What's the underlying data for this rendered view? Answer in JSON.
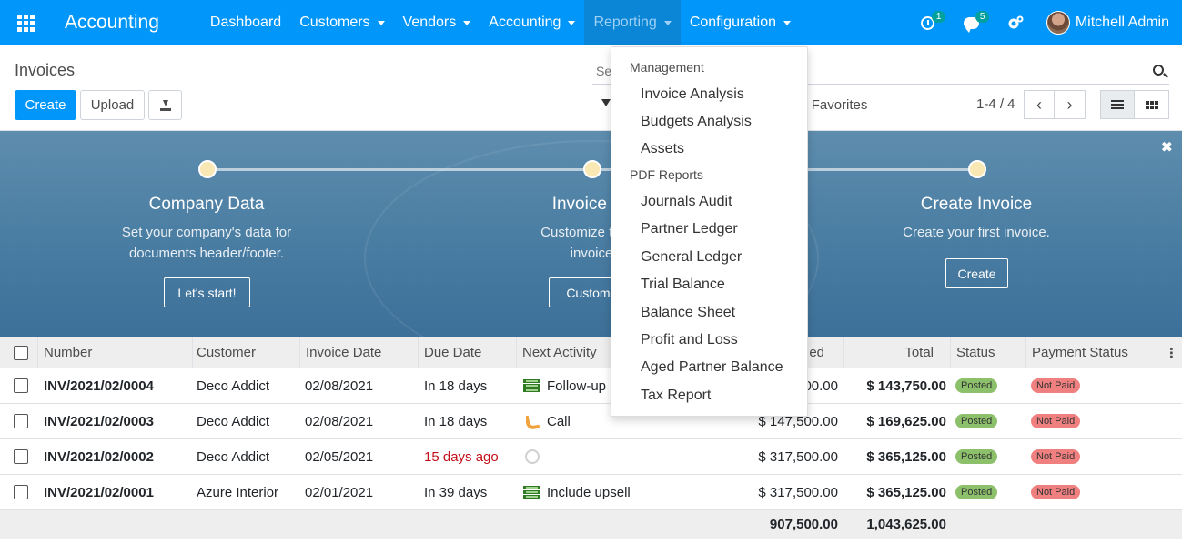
{
  "navbar": {
    "brand": "Accounting",
    "menu": [
      {
        "label": "Dashboard",
        "dropdown": false
      },
      {
        "label": "Customers",
        "dropdown": true
      },
      {
        "label": "Vendors",
        "dropdown": true
      },
      {
        "label": "Accounting",
        "dropdown": true
      },
      {
        "label": "Reporting",
        "dropdown": true
      },
      {
        "label": "Configuration",
        "dropdown": true
      }
    ],
    "activity_count": "1",
    "message_count": "5",
    "user_name": "Mitchell Admin",
    "accent_color": "#0196f9"
  },
  "control": {
    "breadcrumb": "Invoices",
    "create_label": "Create",
    "upload_label": "Upload",
    "search_placeholder": "Search...",
    "favorites_label": "Favorites",
    "pager": "1-4 / 4"
  },
  "banner": {
    "steps": [
      {
        "title": "Company Data",
        "desc_line1": "Set your company's data for",
        "desc_line2": "documents header/footer.",
        "button": "Let's start!"
      },
      {
        "title": "Invoice La",
        "desc_line1": "Customize the lo",
        "desc_line2": "invoice",
        "button": "Customi"
      },
      {
        "title": "Create Invoice",
        "desc_line1": "Create your first invoice.",
        "desc_line2": "",
        "button": "Create"
      }
    ]
  },
  "table": {
    "headers": {
      "number": "Number",
      "customer": "Customer",
      "invoice_date": "Invoice Date",
      "due_date": "Due Date",
      "next_activity": "Next Activity",
      "untaxed": "ed",
      "total": "Total",
      "status": "Status",
      "payment_status": "Payment Status"
    },
    "rows": [
      {
        "number": "INV/2021/02/0004",
        "customer": "Deco Addict",
        "invoice_date": "02/08/2021",
        "due_date": "In 18 days",
        "activity": "Follow-up",
        "activity_icon": "todo-icon",
        "untaxed": "00.00",
        "total": "$ 143,750.00",
        "status": "Posted",
        "payment": "Not Paid"
      },
      {
        "number": "INV/2021/02/0003",
        "customer": "Deco Addict",
        "invoice_date": "02/08/2021",
        "due_date": "In 18 days",
        "activity": "Call",
        "activity_icon": "phone-icon",
        "untaxed": "$ 147,500.00",
        "total": "$ 169,625.00",
        "status": "Posted",
        "payment": "Not Paid"
      },
      {
        "number": "INV/2021/02/0002",
        "customer": "Deco Addict",
        "invoice_date": "02/05/2021",
        "due_date": "15 days ago",
        "activity": "",
        "activity_icon": "clock-icon",
        "untaxed": "$ 317,500.00",
        "total": "$ 365,125.00",
        "status": "Posted",
        "payment": "Not Paid"
      },
      {
        "number": "INV/2021/02/0001",
        "customer": "Azure Interior",
        "invoice_date": "02/01/2021",
        "due_date": "In 39 days",
        "activity": "Include upsell",
        "activity_icon": "todo-icon",
        "untaxed": "$ 317,500.00",
        "total": "$ 365,125.00",
        "status": "Posted",
        "payment": "Not Paid"
      }
    ],
    "footer": {
      "untaxed": "907,500.00",
      "total": "1,043,625.00"
    }
  },
  "dropdown": {
    "section1": "Management",
    "management_items": [
      "Invoice Analysis",
      "Budgets Analysis",
      "Assets"
    ],
    "section2": "PDF Reports",
    "pdf_items": [
      "Journals Audit",
      "Partner Ledger",
      "General Ledger",
      "Trial Balance",
      "Balance Sheet",
      "Profit and Loss",
      "Aged Partner Balance",
      "Tax Report"
    ]
  }
}
